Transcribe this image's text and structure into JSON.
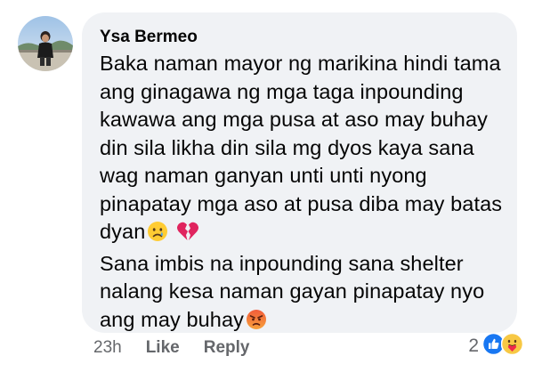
{
  "comment": {
    "author": "Ysa Bermeo",
    "lines": [
      "Baka naman mayor ng marikina hindi tama",
      "ang ginagawa ng mga taga inpounding",
      "kawawa ang mga pusa at aso may buhay",
      "din sila likha din sila mg dyos kaya sana",
      "wag naman ganyan unti unti nyong",
      "pinapatay mga aso at pusa diba may batas",
      "dyan",
      "Sana imbis na inpounding sana shelter",
      "nalang kesa naman gayan pinapatay nyo",
      "ang may buhay"
    ],
    "emojis": {
      "line7": [
        "crying-face-emoji",
        "broken-heart-emoji"
      ],
      "line10": [
        "angry-face-emoji"
      ]
    }
  },
  "actions": {
    "time": "23h",
    "like_label": "Like",
    "reply_label": "Reply"
  },
  "reactions": {
    "count": "2",
    "icons": [
      "like-reaction-icon",
      "care-reaction-icon"
    ]
  },
  "colors": {
    "bubble": "#f0f2f5",
    "text": "#050505",
    "secondary": "#65676b",
    "like_blue": "#1877f2"
  }
}
